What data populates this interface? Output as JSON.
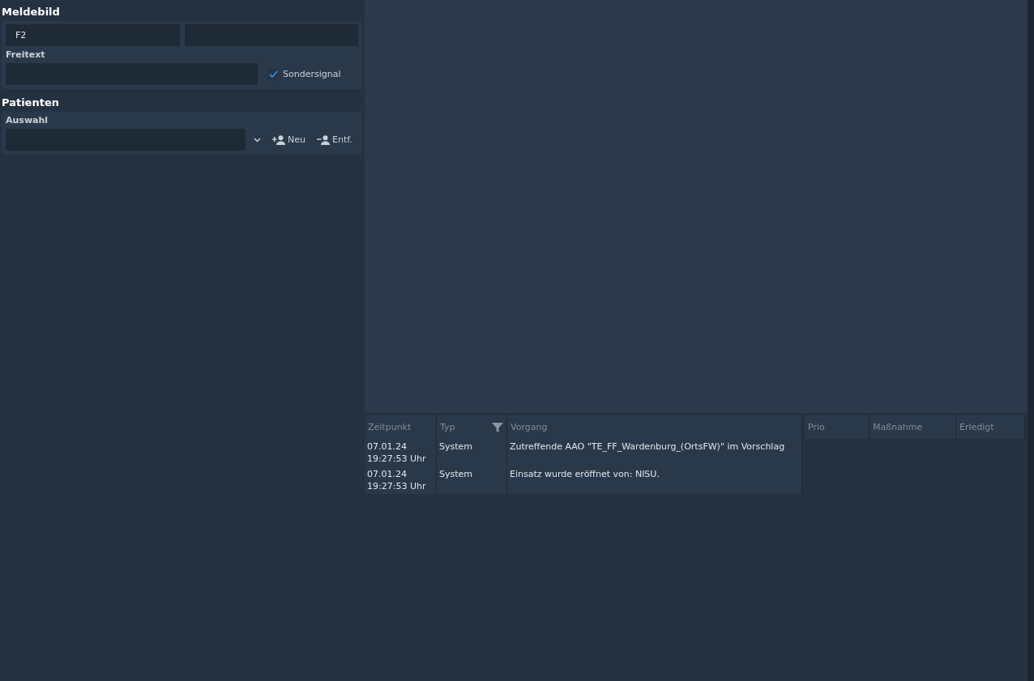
{
  "meldebild": {
    "title": "Meldebild",
    "field_1": {
      "value": "F2"
    },
    "freitext": {
      "label": "Freitext"
    },
    "sondersignal": {
      "label": "Sondersignal",
      "checked": true
    }
  },
  "patienten": {
    "title": "Patienten",
    "auswahl": {
      "label": "Auswahl"
    },
    "buttons": [
      {
        "kind": "add",
        "label": "Neu"
      },
      {
        "kind": "remove",
        "label": "Entf."
      }
    ]
  },
  "log_table": {
    "columns": [
      "Zeitpunkt",
      "Typ",
      "Vorgang"
    ],
    "rows": [
      {
        "zeitpunkt": [
          "07.01.24",
          "19:27:53 Uhr"
        ],
        "typ": "System",
        "vorgang": "Zutreffende AAO \"TE_FF_Wardenburg_(OrtsFW)\" im Vorschlag"
      },
      {
        "zeitpunkt": [
          "07.01.24",
          "19:27:53 Uhr"
        ],
        "typ": "System",
        "vorgang": "Einsatz wurde eröffnet von: NISU."
      }
    ]
  },
  "measures_table": {
    "columns": [
      "Prio",
      "Maßnahme",
      "Erledigt"
    ]
  }
}
